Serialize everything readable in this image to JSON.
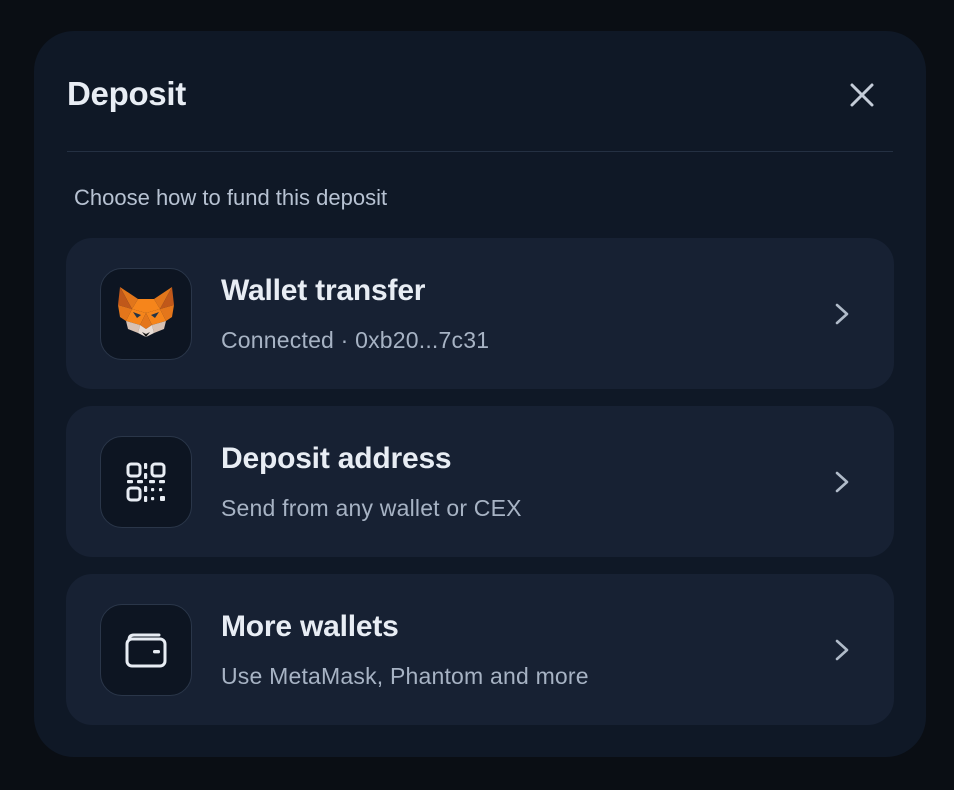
{
  "modal": {
    "title": "Deposit",
    "subtitle": "Choose how to fund this deposit",
    "close_icon": "close-icon"
  },
  "options": [
    {
      "title": "Wallet transfer",
      "description": "Connected · 0xb20...7c31",
      "icon": "metamask-fox-icon"
    },
    {
      "title": "Deposit address",
      "description": "Send from any wallet or CEX",
      "icon": "qr-code-icon"
    },
    {
      "title": "More wallets",
      "description": "Use MetaMask, Phantom and more",
      "icon": "wallet-icon"
    }
  ],
  "colors": {
    "background": "#0a0e14",
    "modal": "#0f1826",
    "card": "#172133",
    "icon_tile": "#0d1522",
    "text_primary": "#e8edf4",
    "text_secondary": "#a7b3c4",
    "fox_orange": "#f6851b"
  }
}
